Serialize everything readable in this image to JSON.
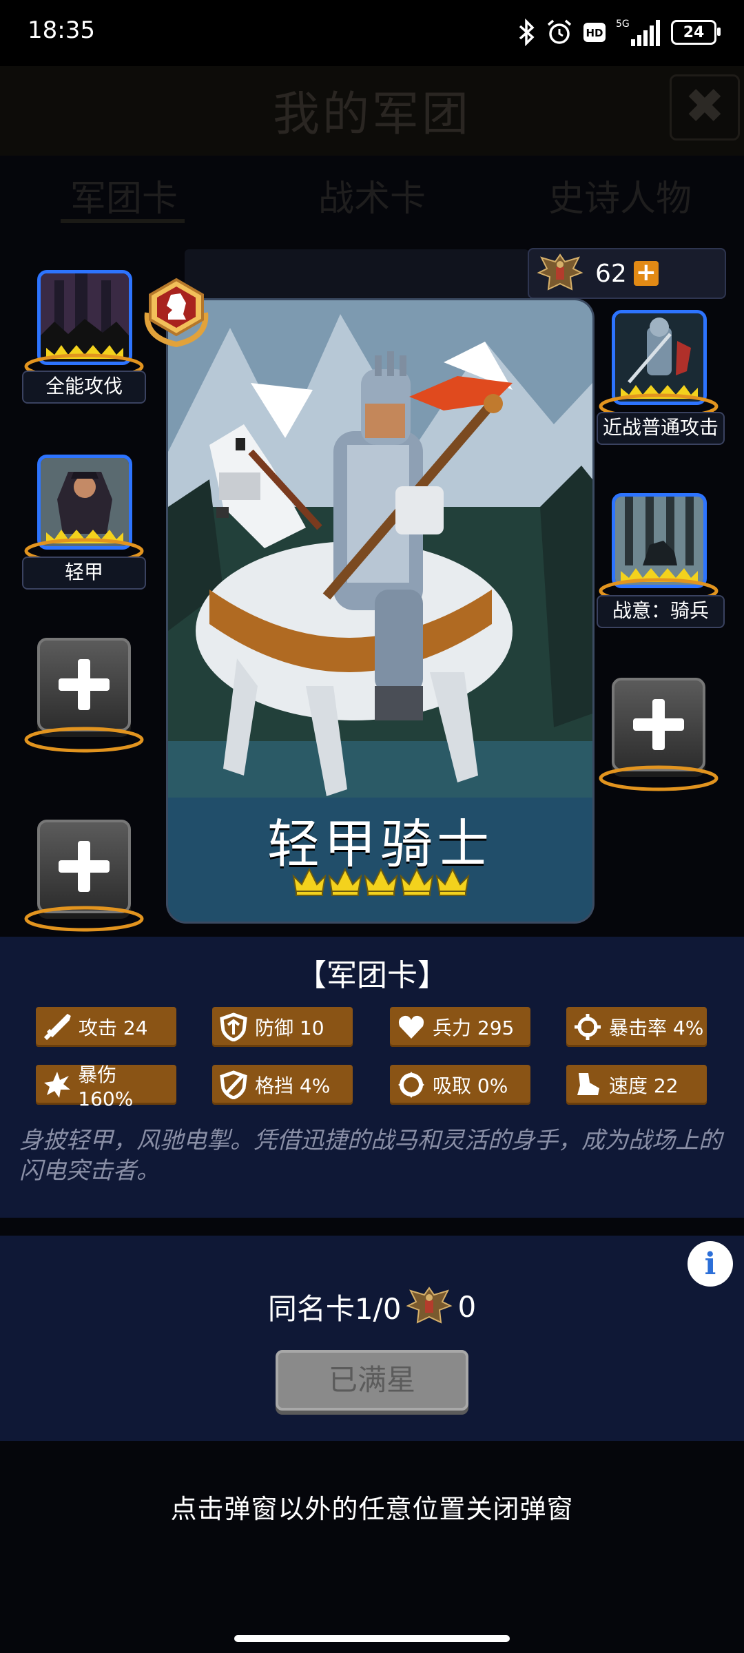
{
  "status_bar": {
    "time": "18:35",
    "battery": "24",
    "network": "5G",
    "hd": "HD",
    "icons": [
      "bluetooth-icon",
      "alarm-icon",
      "hd-icon",
      "signal-icon",
      "battery-icon"
    ]
  },
  "background_page": {
    "title": "我的军团",
    "close_icon": "close-icon",
    "tabs": [
      "军团卡",
      "战术卡",
      "史诗人物"
    ]
  },
  "currency": {
    "amount": "62",
    "add_icon": "plus-icon",
    "emblem_icon": "eagle-crest-icon"
  },
  "card": {
    "name": "轻甲骑士",
    "stars": 5,
    "rank_icon": "knight-chess-badge-icon"
  },
  "skills": {
    "left": [
      {
        "label": "全能攻伐",
        "stars": 5
      },
      {
        "label": "轻甲",
        "stars": 5
      }
    ],
    "right": [
      {
        "label": "近战普通攻击",
        "stars": 5
      },
      {
        "label": "战意：骑兵",
        "stars": 5
      }
    ],
    "empty_slot_icon": "plus-icon"
  },
  "stats_panel": {
    "title": "【军团卡】",
    "stats": [
      {
        "icon": "sword-icon",
        "label": "攻击 24"
      },
      {
        "icon": "shield-icon",
        "label": "防御 10"
      },
      {
        "icon": "heart-icon",
        "label": "兵力 295"
      },
      {
        "icon": "crosshair-icon",
        "label": "暴击率 4%"
      },
      {
        "icon": "burst-icon",
        "label": "暴伤 160%"
      },
      {
        "icon": "block-shield-icon",
        "label": "格挡 4%"
      },
      {
        "icon": "drain-icon",
        "label": "吸取 0%"
      },
      {
        "icon": "boot-icon",
        "label": "速度 22"
      }
    ],
    "description": "身披轻甲，风驰电掣。凭借迅捷的战马和灵活的身手，成为战场上的闪电突击者。"
  },
  "duplicate": {
    "label": "同名卡1/0",
    "count": "0",
    "button": "已满星",
    "info_icon": "info-icon"
  },
  "hint": "点击弹窗以外的任意位置关闭弹窗",
  "colors": {
    "stat_bg": "#8a5415",
    "panel_bg": "#0f1836",
    "slot_border": "#2d74ff",
    "crown": "#f3d21d",
    "orange_accent": "#e28a15"
  }
}
